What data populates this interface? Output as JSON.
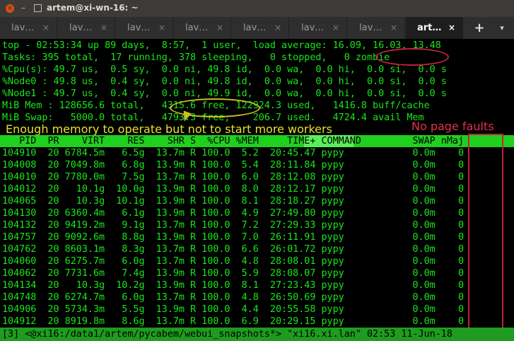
{
  "window": {
    "title": "artem@xi-wn-16: ~",
    "close_icon": "close-icon",
    "minimize_icon": "minimize-icon",
    "maximize_icon": "maximize-icon"
  },
  "tabs": [
    {
      "label": "lav…"
    },
    {
      "label": "lav…"
    },
    {
      "label": "lav…"
    },
    {
      "label": "lav…"
    },
    {
      "label": "lav…"
    },
    {
      "label": "lav…"
    },
    {
      "label": "lav…"
    },
    {
      "label": "art…",
      "active": true
    }
  ],
  "tab_close_glyph": "×",
  "new_tab_glyph": "+",
  "tab_menu_glyph": "▾",
  "top": {
    "line1": "top - 02:53:34 up 89 days,  8:57,  1 user,  load average: 16.09, 16.03, 13.48",
    "line2": "Tasks: 395 total,  17 running, 378 sleeping,   0 stopped,   0 zombie",
    "line3": "%Cpu(s): 49.7 us,  0.5 sy,  0.0 ni, 49.8 id,  0.0 wa,  0.0 hi,  0.0 si,  0.0 s",
    "line4": "%Node0 : 49.8 us,  0.4 sy,  0.0 ni, 49.8 id,  0.0 wa,  0.0 hi,  0.0 si,  0.0 s",
    "line5": "%Node1 : 49.7 us,  0.4 sy,  0.0 ni, 49.9 id,  0.0 wa,  0.0 hi,  0.0 si,  0.0 s",
    "line6": "MiB Mem : 128656.6 total,   4315.6 free, 122924.3 used,   1416.8 buff/cache",
    "line7": "MiB Swap:   5000.0 total,   4793.3 free,    206.7 used.   4724.4 avail Mem"
  },
  "annotations": {
    "memory_note": "Enough  memory to operate but not to start more workers",
    "fault_note": "No page faults"
  },
  "table": {
    "header": "   PID  PR    VIRT    RES    SHR S  %CPU %MEM     TIME+ COMMAND         SWAP nMaj",
    "rows": [
      "104910  20 6784.5m   6.5g  13.7m R 100.0  5.2  20:45.47 pypy            0.0m    0",
      "104008  20 7049.8m   6.8g  13.9m R 100.0  5.4  28:11.84 pypy            0.0m    0",
      "104010  20 7780.0m   7.5g  13.7m R 100.0  6.0  28:12.08 pypy            0.0m    0",
      "104012  20   10.1g  10.0g  13.9m R 100.0  8.0  28:12.17 pypy            0.0m    0",
      "104065  20   10.3g  10.1g  13.9m R 100.0  8.1  28:18.27 pypy            0.0m    0",
      "104130  20 6360.4m   6.1g  13.9m R 100.0  4.9  27:49.80 pypy            0.0m    0",
      "104132  20 9419.2m   9.1g  13.7m R 100.0  7.2  27:29.33 pypy            0.0m    0",
      "104757  20 9092.6m   8.8g  13.9m R 100.0  7.0  26:11.91 pypy            0.0m    0",
      "104762  20 8603.1m   8.3g  13.7m R 100.0  6.6  26:01.72 pypy            0.0m    0",
      "104060  20 6275.7m   6.0g  13.7m R 100.0  4.8  28:08.01 pypy            0.0m    0",
      "104062  20 7731.6m   7.4g  13.9m R 100.0  5.9  28:08.07 pypy            0.0m    0",
      "104134  20   10.3g  10.2g  13.9m R 100.0  8.1  27:23.43 pypy            0.0m    0",
      "104748  20 6274.7m   6.0g  13.7m R 100.0  4.8  26:50.69 pypy            0.0m    0",
      "104906  20 5734.3m   5.5g  13.9m R 100.0  4.4  20:55.58 pypy            0.0m    0",
      "104912  20 8919.8m   8.6g  13.7m R 100.0  6.9  20:29.15 pypy            0.0m    0"
    ]
  },
  "status_bar": "[3] <@xi16:/data1/artem/pycabem/webui_snapshots*> \"xi16.xi.lan\" 02:53 11-Jun-18",
  "colors": {
    "terminal_bg": "#000000",
    "terminal_fg": "#19e619",
    "header_bg": "#1fd01f",
    "annotation_yellow": "#e8e02a",
    "annotation_red": "#e6314c"
  }
}
